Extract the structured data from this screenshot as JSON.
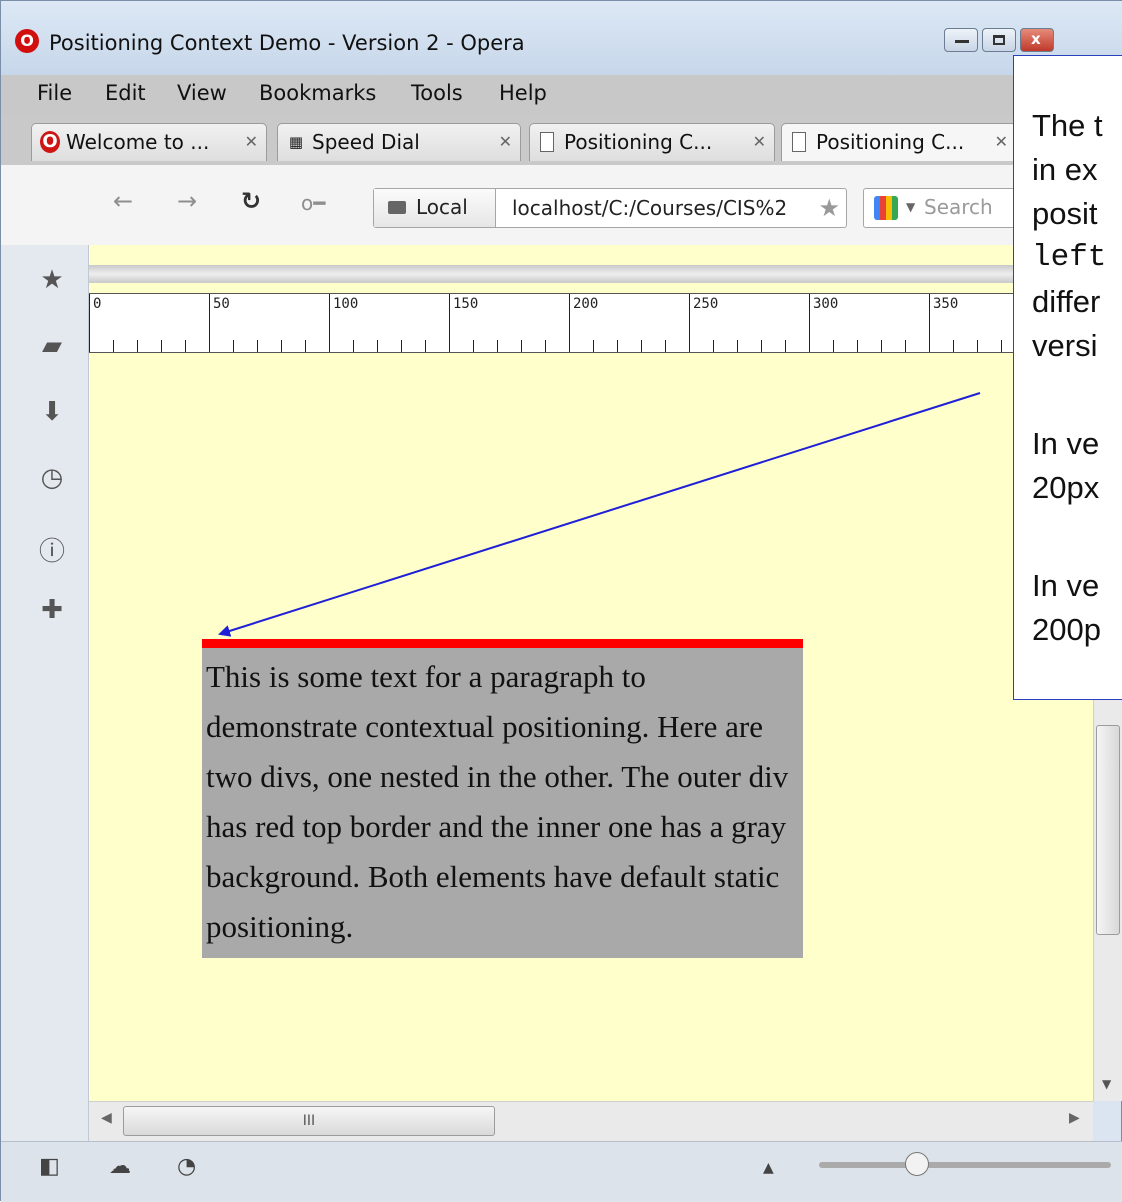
{
  "window": {
    "title": "Positioning Context Demo - Version 2 - Opera",
    "close_symbol": "x"
  },
  "menu": [
    "File",
    "Edit",
    "View",
    "Bookmarks",
    "Tools",
    "Help"
  ],
  "tabs": [
    {
      "label": "Welcome to ...",
      "icon": "opera-icon"
    },
    {
      "label": "Speed Dial",
      "icon": "speed-dial-icon"
    },
    {
      "label": "Positioning C...",
      "icon": "page-icon"
    },
    {
      "label": "Positioning C...",
      "icon": "page-icon"
    }
  ],
  "address": {
    "badge": "Local",
    "url": "localhost/C:/Courses/CIS%2",
    "search_placeholder": "Search"
  },
  "ruler": {
    "labels": [
      "0",
      "50",
      "100",
      "150",
      "200",
      "250",
      "300",
      "350"
    ]
  },
  "demo": {
    "paragraph": "This is some text for a paragraph to demonstrate contextual positioning. Here are two divs, one nested in the other. The outer div has red top border and the inner one has a gray background. Both elements have default static positioning."
  },
  "scroll": {
    "h_thumb_grip": "III"
  },
  "callout": {
    "lines": [
      "The t",
      "in ex",
      "posit",
      "left",
      "differ",
      "versi",
      "In ve",
      "20px",
      "In ve",
      "200p"
    ]
  },
  "colors": {
    "content_bg": "#ffffcc",
    "border_red": "#ff0000",
    "box_gray": "#a9a9a9",
    "arrow_blue": "#1f1fd6"
  }
}
